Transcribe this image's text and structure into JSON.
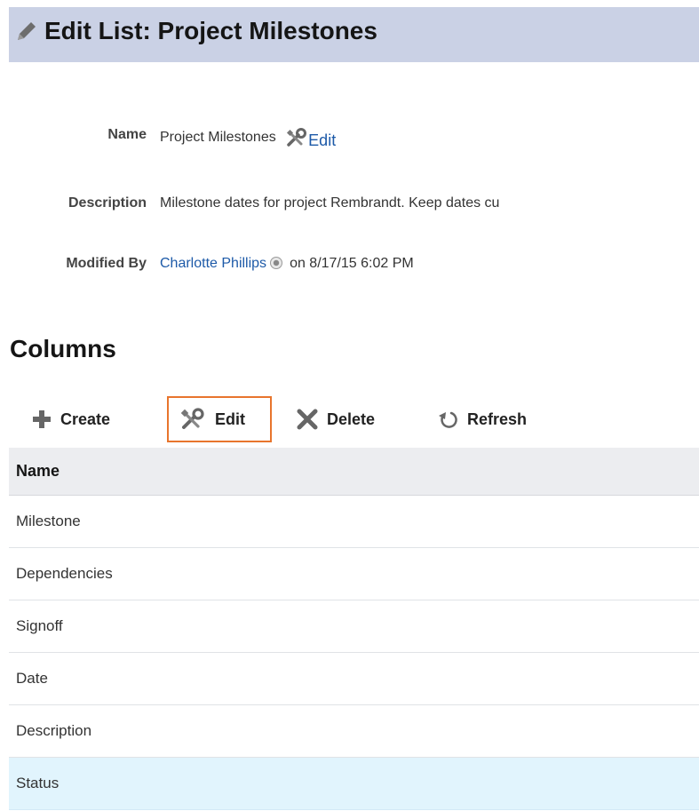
{
  "header": {
    "title": "Edit List: Project Milestones",
    "icon": "pencil-icon"
  },
  "details": {
    "name_label": "Name",
    "name_value": "Project Milestones",
    "name_edit_link": "Edit",
    "description_label": "Description",
    "description_value": "Milestone dates for project Rembrandt. Keep dates cu",
    "modified_by_label": "Modified By",
    "modified_by_user": "Charlotte Phillips",
    "modified_on": "on 8/17/15 6:02 PM"
  },
  "columns_section": {
    "title": "Columns",
    "toolbar": {
      "create_label": "Create",
      "edit_label": "Edit",
      "delete_label": "Delete",
      "refresh_label": "Refresh"
    },
    "table": {
      "header_name": "Name",
      "rows": [
        "Milestone",
        "Dependencies",
        "Signoff",
        "Date",
        "Description",
        "Status"
      ],
      "selected_row": "Status"
    }
  },
  "colors": {
    "title_bar": "#cad1e5",
    "link": "#1d5aa8",
    "highlight_border": "#e8752d",
    "selected_row": "#e1f4fd"
  }
}
